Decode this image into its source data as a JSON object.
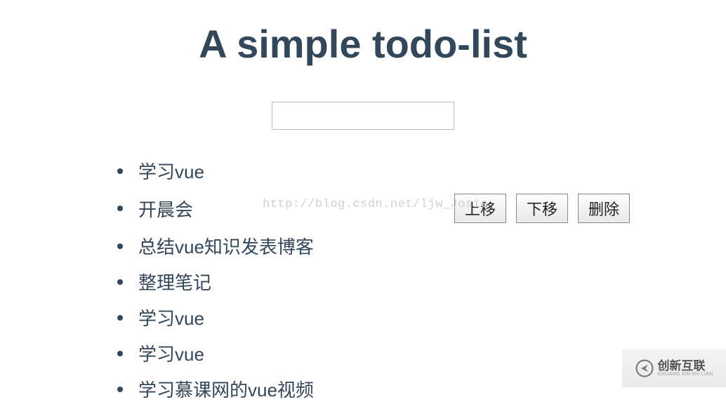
{
  "title": "A simple todo-list",
  "input": {
    "value": "",
    "placeholder": ""
  },
  "items": [
    {
      "text": "学习vue",
      "active": false
    },
    {
      "text": "开晨会",
      "active": true
    },
    {
      "text": "总结vue知识发表博客",
      "active": false
    },
    {
      "text": "整理笔记",
      "active": false
    },
    {
      "text": "学习vue",
      "active": false
    },
    {
      "text": "学习vue",
      "active": false
    },
    {
      "text": "学习慕课网的vue视频",
      "active": false
    }
  ],
  "buttons": {
    "move_up": "上移",
    "move_down": "下移",
    "delete": "删除"
  },
  "watermark": {
    "url": "http://blog.csdn.net/ljw_Josie",
    "logo_main": "创新互联",
    "logo_sub": "CHUANG XIN HU LIAN"
  }
}
